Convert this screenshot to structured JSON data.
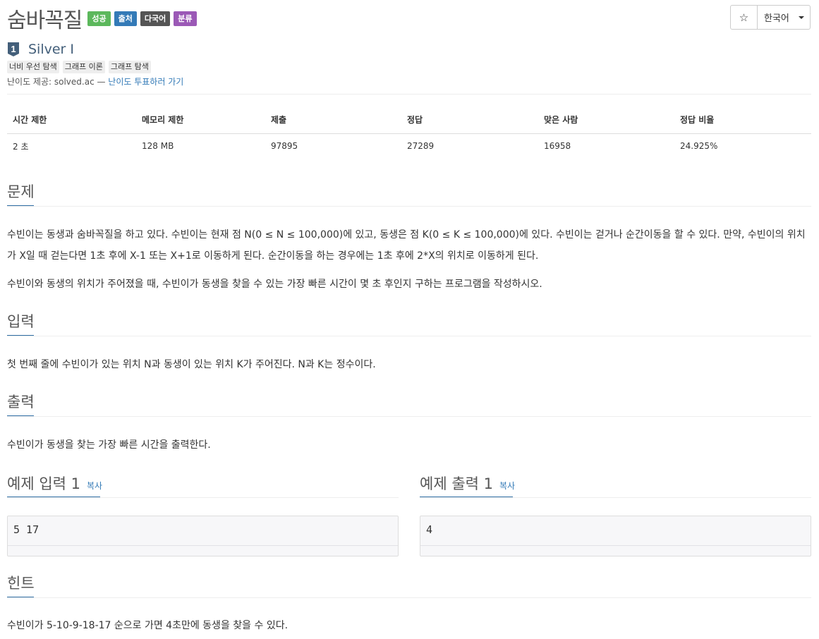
{
  "problem": {
    "title": "숨바꼭질",
    "badges": {
      "success": "성공",
      "source": "출처",
      "multilang": "다국어",
      "classified": "분류"
    },
    "tier": {
      "number": "1",
      "label": "Silver I"
    },
    "tags": [
      "너비 우선 탐색",
      "그래프 이론",
      "그래프 탐색"
    ],
    "difficulty": {
      "prefix": "난이도 제공: solved.ac — ",
      "vote_link": "난이도 투표하러 가기"
    }
  },
  "controls": {
    "star": "☆",
    "language": "한국어"
  },
  "info_table": {
    "headers": [
      "시간 제한",
      "메모리 제한",
      "제출",
      "정답",
      "맞은 사람",
      "정답 비율"
    ],
    "values": [
      "2 초",
      "128 MB",
      "97895",
      "27289",
      "16958",
      "24.925%"
    ]
  },
  "sections": {
    "description": {
      "heading": "문제",
      "p1": "수빈이는 동생과 숨바꼭질을 하고 있다. 수빈이는 현재 점 N(0 ≤ N ≤ 100,000)에 있고, 동생은 점 K(0 ≤ K ≤ 100,000)에 있다. 수빈이는 걷거나 순간이동을 할 수 있다. 만약, 수빈이의 위치가 X일 때 걷는다면 1초 후에 X-1 또는 X+1로 이동하게 된다. 순간이동을 하는 경우에는 1초 후에 2*X의 위치로 이동하게 된다.",
      "p2": "수빈이와 동생의 위치가 주어졌을 때, 수빈이가 동생을 찾을 수 있는 가장 빠른 시간이 몇 초 후인지 구하는 프로그램을 작성하시오."
    },
    "input": {
      "heading": "입력",
      "text": "첫 번째 줄에 수빈이가 있는 위치 N과 동생이 있는 위치 K가 주어진다. N과 K는 정수이다."
    },
    "output": {
      "heading": "출력",
      "text": "수빈이가 동생을 찾는 가장 빠른 시간을 출력한다."
    },
    "sample_input": {
      "heading": "예제 입력 1",
      "copy": "복사",
      "data": "5 17"
    },
    "sample_output": {
      "heading": "예제 출력 1",
      "copy": "복사",
      "data": "4"
    },
    "hint": {
      "heading": "힌트",
      "text": "수빈이가 5-10-9-18-17 순으로 가면 4초만에 동생을 찾을 수 있다."
    }
  }
}
